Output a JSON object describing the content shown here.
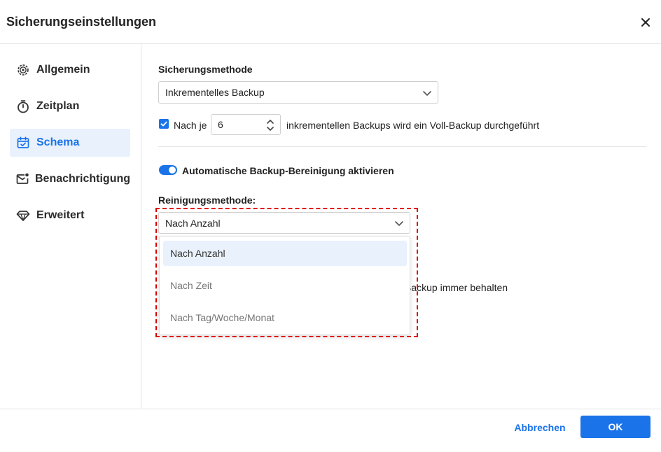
{
  "window": {
    "title": "Sicherungseinstellungen"
  },
  "sidebar": {
    "items": [
      {
        "label": "Allgemein",
        "icon": "gear-icon",
        "active": false
      },
      {
        "label": "Zeitplan",
        "icon": "stopwatch-icon",
        "active": false
      },
      {
        "label": "Schema",
        "icon": "calendar-check-icon",
        "active": true
      },
      {
        "label": "Benachrichtigung",
        "icon": "mail-notification-icon",
        "active": false
      },
      {
        "label": "Erweitert",
        "icon": "diamond-icon",
        "active": false
      }
    ]
  },
  "main": {
    "backup_method_label": "Sicherungsmethode",
    "backup_method_value": "Inkrementelles Backup",
    "full_backup": {
      "checked": true,
      "prefix": "Nach je",
      "value": "6",
      "suffix": "inkrementellen Backups wird ein Voll-Backup durchgeführt"
    },
    "auto_cleanup": {
      "enabled": true,
      "label": "Automatische Backup-Bereinigung aktivieren"
    },
    "cleanup_method_label": "Reinigungsmethode:",
    "cleanup_method_value": "Nach Anzahl",
    "cleanup_options": [
      "Nach Anzahl",
      "Nach Zeit",
      "Nach Tag/Woche/Monat"
    ],
    "partial_behind_text": "Backup immer behalten"
  },
  "footer": {
    "cancel_label": "Abbrechen",
    "ok_label": "OK"
  },
  "colors": {
    "accent": "#1a73e8",
    "highlight": "#e00000",
    "active_bg": "#e8f1fc"
  }
}
